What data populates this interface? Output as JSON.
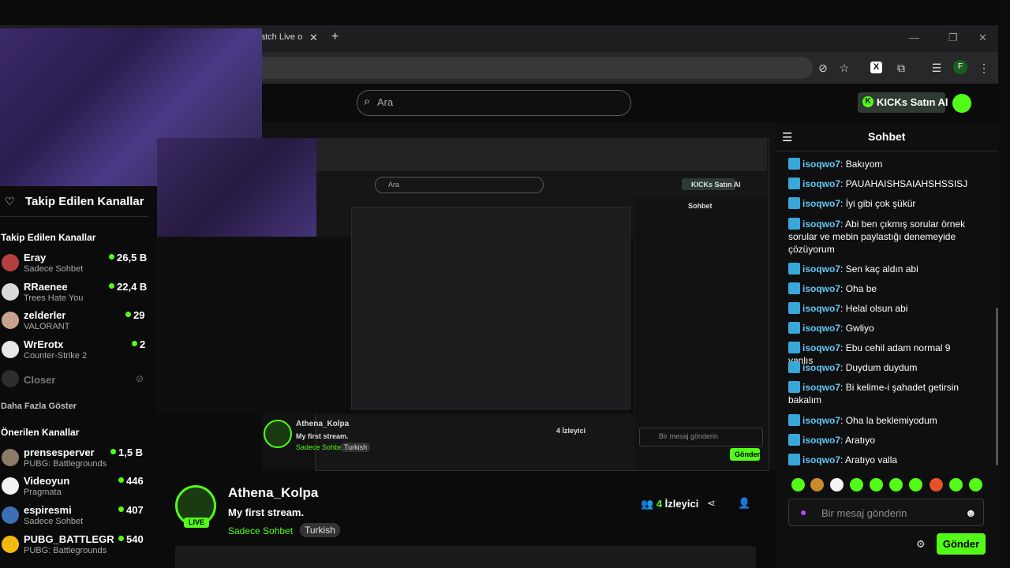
{
  "browser": {
    "tab_title": "atch Live o",
    "tab_close": "✕",
    "new_tab": "+",
    "profile_initial": "F"
  },
  "header": {
    "search_placeholder": "Ara",
    "buy_kicks_label": "KICKs Satın Al"
  },
  "sidebar": {
    "title": "Takip Edilen Kanallar",
    "followed_section": "Takip Edilen Kanallar",
    "followed": [
      {
        "name": "Eray",
        "sub": "Sadece Sohbet",
        "count": "26,5 B",
        "color": "#b5413e"
      },
      {
        "name": "RRaenee",
        "sub": "Trees Hate You",
        "count": "22,4 B",
        "color": "#d9d9d9"
      },
      {
        "name": "zelderler",
        "sub": "VALORANT",
        "count": "29",
        "color": "#c7a38f"
      },
      {
        "name": "WrErotx",
        "sub": "Counter-Strike 2",
        "count": "2",
        "color": "#e8e8e8"
      }
    ],
    "offline": {
      "name": "Closer"
    },
    "show_more": "Daha Fazla Göster",
    "recommended_section": "Önerilen Kanallar",
    "recommended": [
      {
        "name": "prensesperver",
        "sub": "PUBG: Battlegrounds",
        "count": "1,5 B",
        "color": "#8a7a66"
      },
      {
        "name": "Videoyun",
        "sub": "Pragmata",
        "count": "446",
        "color": "#f2f2f2"
      },
      {
        "name": "espiresmi",
        "sub": "Sadece Sohbet",
        "count": "407",
        "color": "#3b6fb4"
      },
      {
        "name": "PUBG_BATTLEGR...",
        "sub": "PUBG: Battlegrounds",
        "count": "540",
        "color": "#f2b90f"
      }
    ]
  },
  "nested": {
    "sohbet": "Sohbet",
    "ara": "Ara",
    "kicks": "KICKs Satın Al",
    "streamer": "Athena_Kolpa",
    "title": "My first stream.",
    "category": "Sadece Sohbet",
    "tag": "Turkish",
    "viewers": "4 İzleyici",
    "placeholder": "Bir mesaj gönderin",
    "send": "Gönder"
  },
  "stream": {
    "live_badge": "LIVE",
    "streamer": "Athena_Kolpa",
    "title": "My first stream.",
    "category": "Sadece Sohbet",
    "tag": "Turkish",
    "viewer_count": "4",
    "viewer_label": "İzleyici"
  },
  "chat": {
    "title": "Sohbet",
    "messages": [
      {
        "user": "isoqwo7",
        "text": "Bakıyom"
      },
      {
        "user": "isoqwo7",
        "text": "PAUAHAISHSAIAHSHSSISJ"
      },
      {
        "user": "isoqwo7",
        "text": "İyi gibi çok şükür"
      },
      {
        "user": "isoqwo7",
        "text": "Abi ben çıkmış sorular örnek sorular ve mebin paylastığı denemeyide çözüyorum"
      },
      {
        "user": "isoqwo7",
        "text": "Sen kaç aldın abi"
      },
      {
        "user": "isoqwo7",
        "text": "Oha be"
      },
      {
        "user": "isoqwo7",
        "text": "Helal olsun abi"
      },
      {
        "user": "isoqwo7",
        "text": "Gwliyo"
      },
      {
        "user": "isoqwo7",
        "text": "Ebu cehil adam normal 9 yanlıs"
      },
      {
        "user": "isoqwo7",
        "text": "Duydum duydum"
      },
      {
        "user": "isoqwo7",
        "text": "Bi kelime-i şahadet getirsin bakalım"
      },
      {
        "user": "isoqwo7",
        "text": "Oha la beklemiyodum"
      },
      {
        "user": "isoqwo7",
        "text": "Aratıyo"
      },
      {
        "user": "isoqwo7",
        "text": "Aratıyo valla"
      }
    ],
    "input_placeholder": "Bir mesaj gönderin",
    "send_label": "Gönder",
    "emote_colors": [
      "#53fc18",
      "#c98a2d",
      "#f4f4f4",
      "#53fc18",
      "#53fc18",
      "#53fc18",
      "#53fc18",
      "#e5532a",
      "#53fc18",
      "#53fc18"
    ]
  },
  "colors": {
    "accent": "#53fc18",
    "username": "#61c8f5"
  }
}
